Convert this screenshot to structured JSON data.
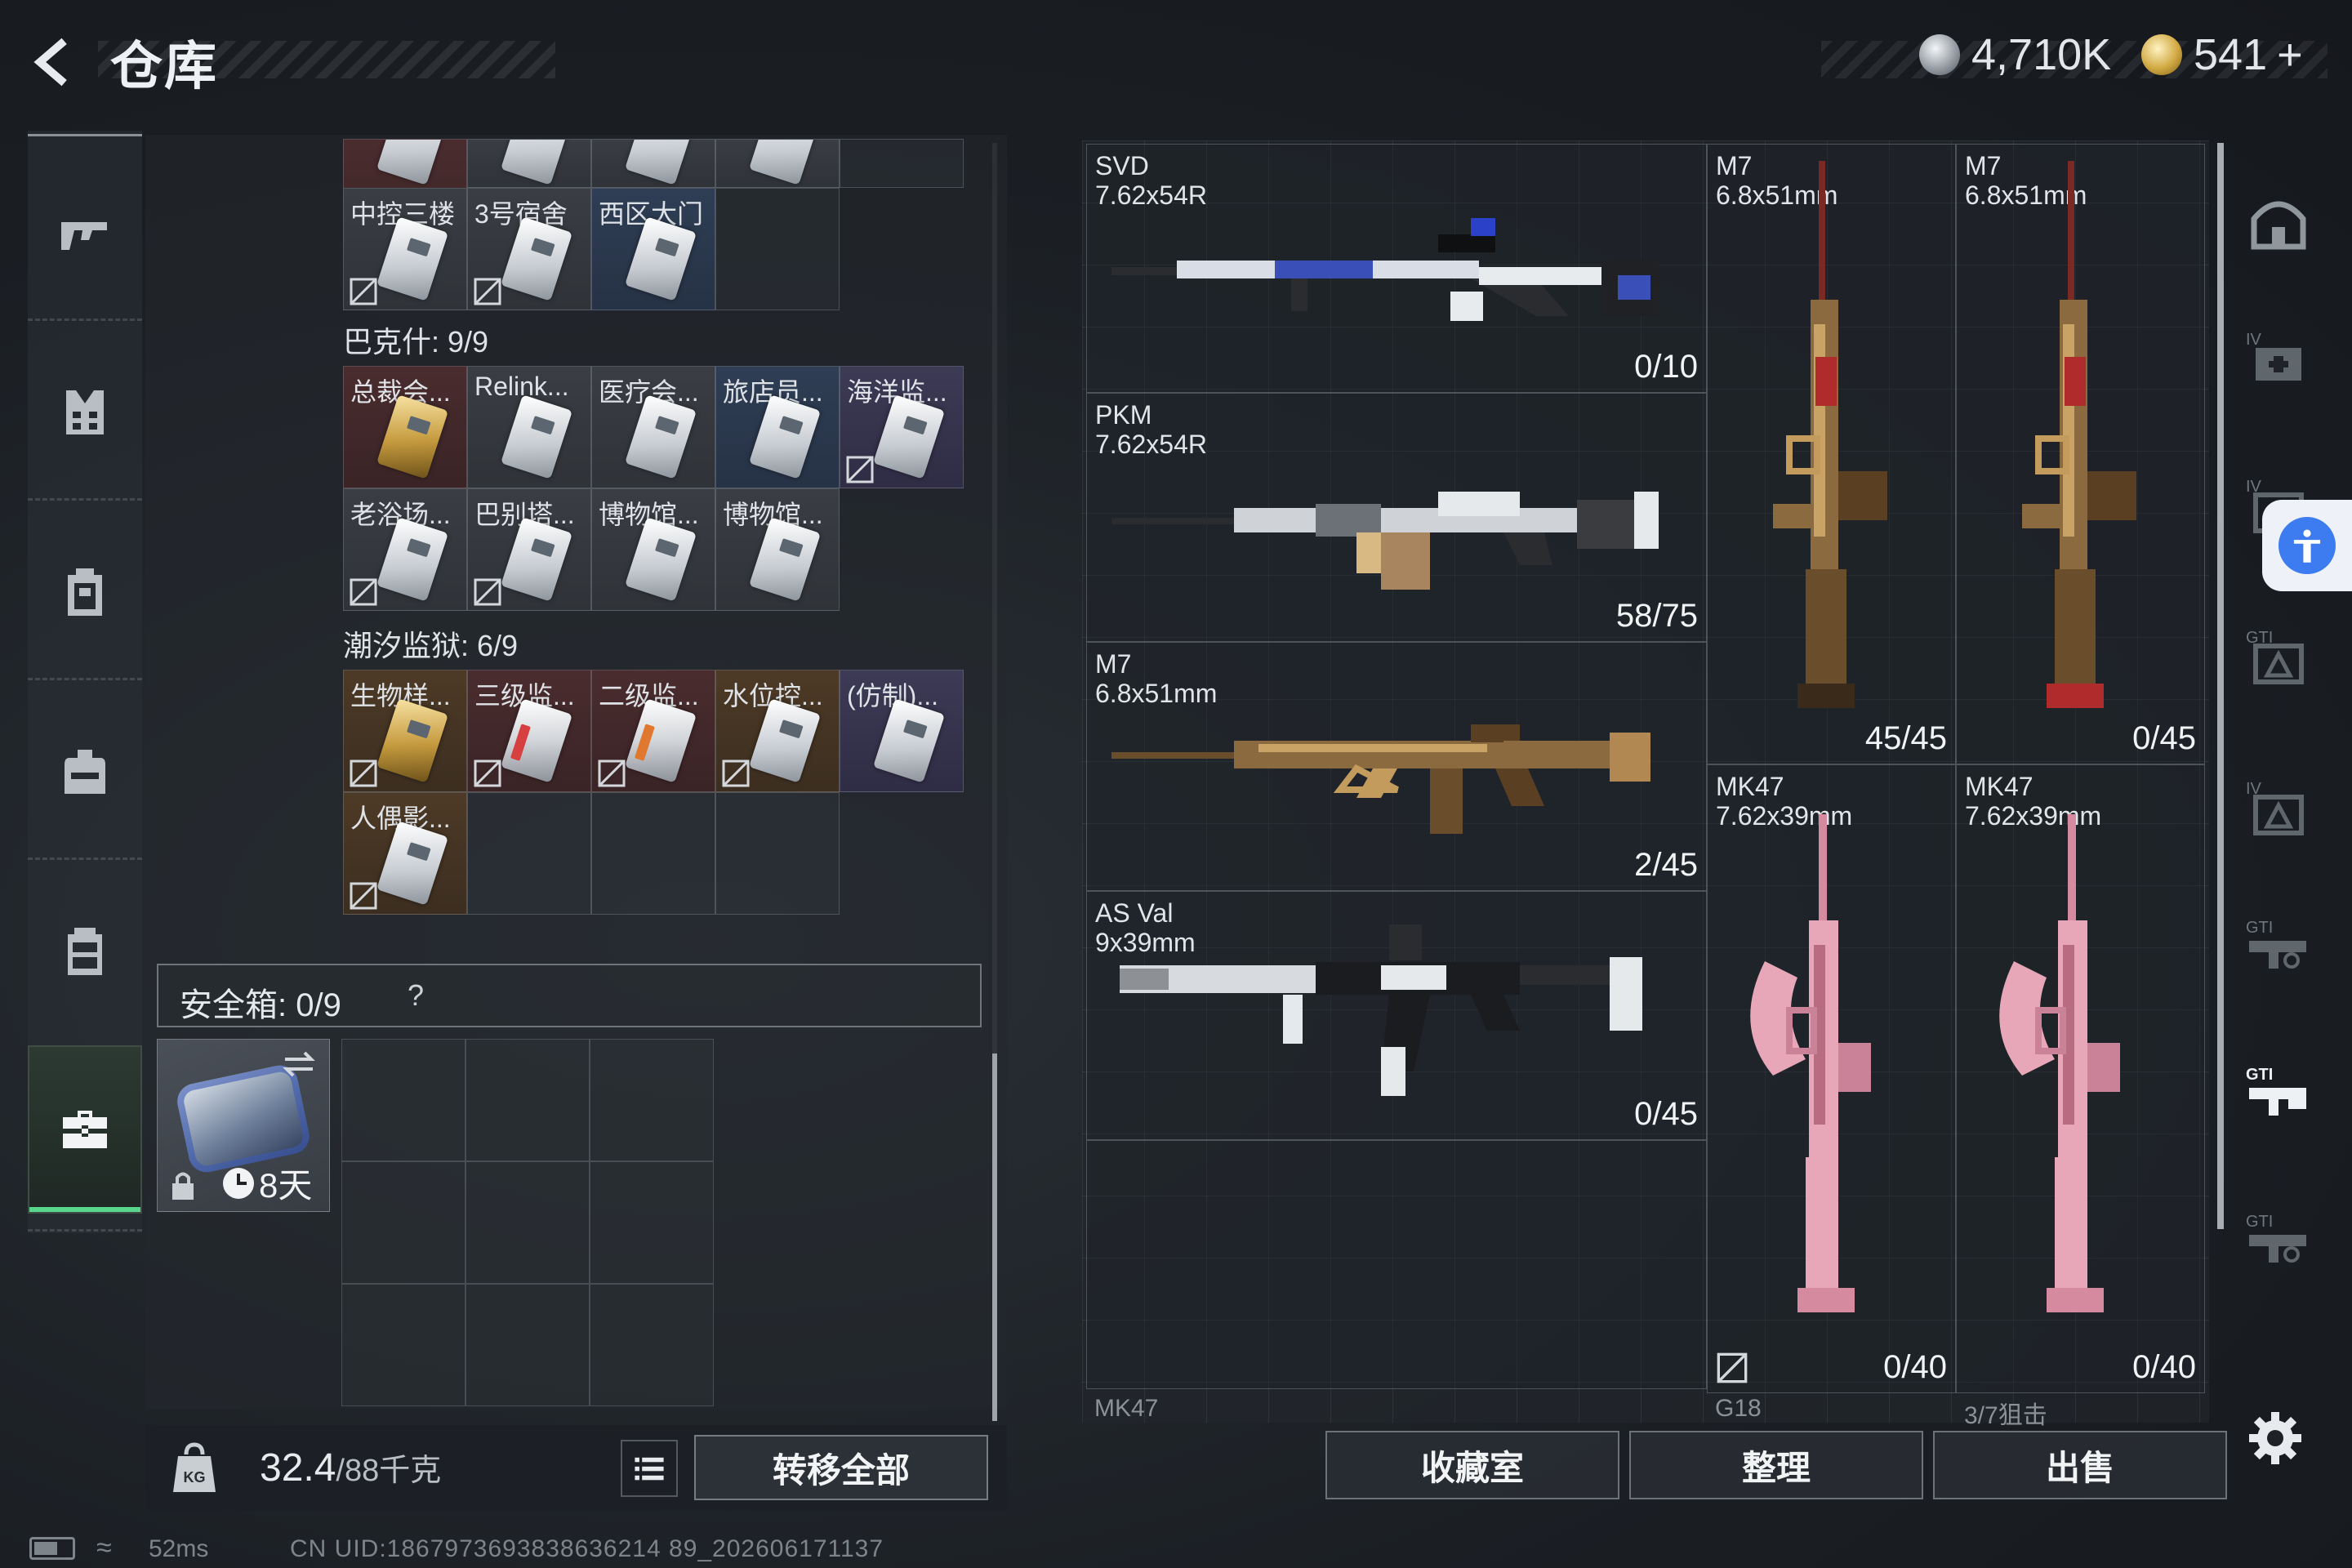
{
  "header": {
    "title": "仓库",
    "currency": [
      {
        "icon": "silver-coin-icon",
        "value": "4,710K"
      },
      {
        "icon": "gold-coin-icon",
        "value": "541",
        "suffix": "+"
      }
    ]
  },
  "left_rail": {
    "items": [
      {
        "icon": "gun-icon"
      },
      {
        "icon": "armor-icon"
      },
      {
        "icon": "backpack-icon"
      },
      {
        "icon": "bag-icon"
      },
      {
        "icon": "container-icon"
      },
      {
        "icon": "briefcase-icon",
        "active": true
      }
    ]
  },
  "inventory": {
    "top_row_labels": [
      "中控三楼",
      "3号宿舍",
      "西区大门"
    ],
    "sections": [
      {
        "label": "巴克什: 9/9",
        "cards": [
          {
            "label": "总裁会...",
            "rarity": "red"
          },
          {
            "label": "Relink...",
            "rarity": "grey"
          },
          {
            "label": "医疗会...",
            "rarity": "grey"
          },
          {
            "label": "旅店员...",
            "rarity": "grey"
          },
          {
            "label": "海洋监...",
            "rarity": "purple"
          },
          {
            "label": "老浴场...",
            "rarity": "grey"
          },
          {
            "label": "巴别塔...",
            "rarity": "grey"
          },
          {
            "label": "博物馆...",
            "rarity": "grey"
          },
          {
            "label": "博物馆...",
            "rarity": "grey"
          }
        ]
      },
      {
        "label": "潮汐监狱: 6/9",
        "cards": [
          {
            "label": "生物样...",
            "rarity": "gold"
          },
          {
            "label": "三级监...",
            "rarity": "red"
          },
          {
            "label": "二级监...",
            "rarity": "red"
          },
          {
            "label": "水位控...",
            "rarity": "gold"
          },
          {
            "label": "(仿制)...",
            "rarity": "purple"
          },
          {
            "label": "人偶影...",
            "rarity": "gold"
          }
        ]
      }
    ],
    "safebox": {
      "label": "安全箱: 0/9",
      "help": "?",
      "days": "8天"
    },
    "weight": {
      "current": "32.4",
      "max": "/88千克"
    },
    "transfer_all": "转移全部"
  },
  "weapons": [
    {
      "name": "SVD",
      "caliber": "7.62x54R",
      "count": "0/10"
    },
    {
      "name": "PKM",
      "caliber": "7.62x54R",
      "count": "58/75"
    },
    {
      "name": "M7",
      "caliber": "6.8x51mm",
      "count": "2/45"
    },
    {
      "name": "AS Val",
      "caliber": "9x39mm",
      "count": "0/45"
    },
    {
      "name": "M7",
      "caliber": "6.8x51mm",
      "count": "45/45"
    },
    {
      "name": "M7",
      "caliber": "6.8x51mm",
      "count": "0/45"
    },
    {
      "name": "MK47",
      "caliber": "7.62x39mm",
      "count": "0/40"
    },
    {
      "name": "MK47",
      "caliber": "7.62x39mm",
      "count": "0/40"
    }
  ],
  "weapon_peek": [
    "MK47",
    "G18",
    "3/7狙击"
  ],
  "actions": {
    "collection": "收藏室",
    "sort": "整理",
    "sell": "出售"
  },
  "right_tabs": [
    "home-tab",
    "IV-medkit-tab",
    "IV-armor-tab",
    "GTI-armor-tab",
    "IV-vest-tab",
    "GTI-gun-tab",
    "GTI-gun-selected-tab",
    "GTI-gun-tab-2"
  ],
  "status": {
    "ping": "52ms",
    "uid": "CN UID:1867973693838636214 89_202606171137"
  },
  "colors": {
    "accent_green": "#58d68d",
    "rarity_red": "#4a2c2e",
    "rarity_gold": "#4d3a26",
    "rarity_purple": "#3d3a55"
  }
}
